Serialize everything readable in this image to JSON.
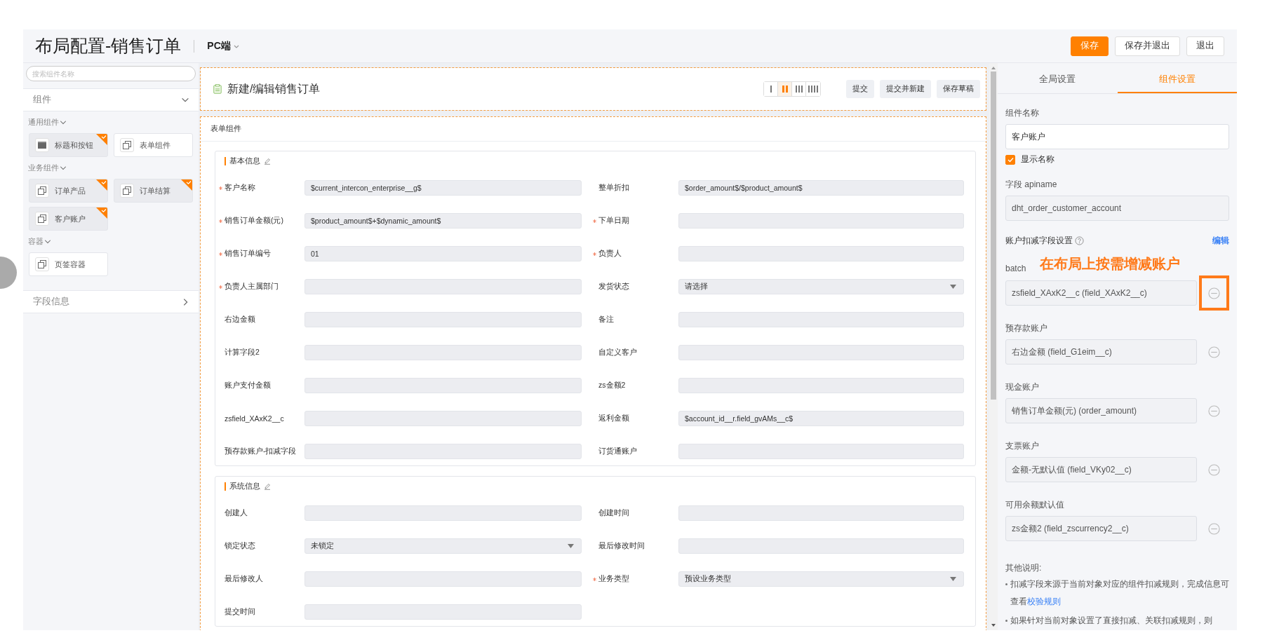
{
  "header": {
    "title": "布局配置-销售订单",
    "platform": "PC端",
    "buttons": [
      {
        "label": "保存",
        "primary": true
      },
      {
        "label": "保存并退出",
        "primary": false
      },
      {
        "label": "退出",
        "primary": false
      }
    ]
  },
  "left_panel": {
    "search": {
      "placeholder": "搜索组件名称"
    },
    "sections": [
      {
        "title": "组件",
        "expanded": true,
        "groups": [
          {
            "title": "通用组件",
            "expanded": true,
            "items": [
              {
                "label": "标题和按钮",
                "kind": "block",
                "added": true
              },
              {
                "label": "表单组件",
                "kind": "frame",
                "added": false
              }
            ]
          },
          {
            "title": "业务组件",
            "expanded": true,
            "items": [
              {
                "label": "订单产品",
                "kind": "frame",
                "added": true
              },
              {
                "label": "订单结算",
                "kind": "frame",
                "added": true
              },
              {
                "label": "客户账户",
                "kind": "frame",
                "added": true
              }
            ]
          },
          {
            "title": "容器",
            "expanded": true,
            "items": [
              {
                "label": "页签容器",
                "kind": "frame",
                "added": false
              }
            ]
          }
        ]
      },
      {
        "title": "字段信息",
        "expanded": false
      }
    ]
  },
  "canvas": {
    "title": "新建/编辑销售订单",
    "layout_options": [
      {
        "selected": false
      },
      {
        "selected": true
      },
      {
        "selected": false
      },
      {
        "selected": false
      }
    ],
    "buttons": [
      "提交",
      "提交并新建",
      "保存草稿"
    ],
    "form": {
      "title": "表单组件",
      "sections": [
        {
          "title": "基本信息",
          "fields": [
            {
              "label": "客户名称",
              "required": true,
              "kind": "text",
              "value": "$current_intercon_enterprise__g$"
            },
            {
              "label": "整单折扣",
              "required": false,
              "kind": "text",
              "value": "$order_amount$/$product_amount$"
            },
            {
              "label": "销售订单金额(元)",
              "required": true,
              "kind": "text",
              "value": "$product_amount$+$dynamic_amount$"
            },
            {
              "label": "下单日期",
              "required": true,
              "kind": "text"
            },
            {
              "label": "销售订单编号",
              "required": true,
              "kind": "text",
              "value": "01"
            },
            {
              "label": "负责人",
              "required": true,
              "kind": "text"
            },
            {
              "label": "负责人主属部门",
              "required": true,
              "kind": "text"
            },
            {
              "label": "发货状态",
              "required": false,
              "kind": "select",
              "value": "请选择"
            },
            {
              "label": "右边金额",
              "required": false,
              "kind": "text"
            },
            {
              "label": "备注",
              "required": false,
              "kind": "text"
            },
            {
              "label": "计算字段2",
              "required": false,
              "kind": "text"
            },
            {
              "label": "自定义客户",
              "required": false,
              "kind": "text"
            },
            {
              "label": "账户支付金额",
              "required": false,
              "kind": "text"
            },
            {
              "label": "zs金额2",
              "required": false,
              "kind": "text"
            },
            {
              "label": "zsfield_XAxK2__c",
              "required": false,
              "kind": "text"
            },
            {
              "label": "返利金额",
              "required": false,
              "kind": "text",
              "value": "$account_id__r.field_gvAMs__c$"
            },
            {
              "label": "预存款账户-扣减字段",
              "required": false,
              "kind": "text"
            },
            {
              "label": "订货通账户",
              "required": false,
              "kind": "text"
            }
          ]
        },
        {
          "title": "系统信息",
          "fields": [
            {
              "label": "创建人",
              "required": false,
              "kind": "text"
            },
            {
              "label": "创建时间",
              "required": false,
              "kind": "text"
            },
            {
              "label": "锁定状态",
              "required": false,
              "kind": "select",
              "value": "未锁定"
            },
            {
              "label": "最后修改时间",
              "required": false,
              "kind": "text"
            },
            {
              "label": "最后修改人",
              "required": false,
              "kind": "text"
            },
            {
              "label": "业务类型",
              "required": true,
              "kind": "select",
              "value": "预设业务类型"
            },
            {
              "label": "提交时间",
              "required": false,
              "kind": "text"
            }
          ]
        }
      ]
    }
  },
  "right_panel": {
    "tabs": [
      {
        "label": "全局设置",
        "selected": false
      },
      {
        "label": "组件设置",
        "selected": true
      }
    ],
    "component_name": {
      "label": "组件名称",
      "value": "客户账户"
    },
    "show_name": {
      "label": "显示名称",
      "checked": true
    },
    "apiname": {
      "label": "字段 apiname",
      "value": "dht_order_customer_account"
    },
    "deduction": {
      "title": "账户扣减字段设置",
      "edit_link": "编辑",
      "annotation": "在布局上按需增减账户",
      "accounts": [
        {
          "name": "batch",
          "value": "zsfield_XAxK2__c (field_XAxK2__c)",
          "highlighted": true
        },
        {
          "name": "预存款账户",
          "value": "右边金额 (field_G1eim__c)",
          "highlighted": false
        },
        {
          "name": "现金账户",
          "value": "销售订单金额(元) (order_amount)",
          "highlighted": false
        },
        {
          "name": "支票账户",
          "value": "金额-无默认值 (field_VKy02__c)",
          "highlighted": false
        },
        {
          "name": "可用余额默认值",
          "value": "zs金额2 (field_zscurrency2__c)",
          "highlighted": false
        }
      ]
    },
    "notes": {
      "title": "其他说明:",
      "items": [
        {
          "text": "扣减字段来源于当前对象对应的组件扣减规则，完成信息可查看",
          "link": "校验规则"
        },
        {
          "text": "如果针对当前对象设置了直接扣减、关联扣减规则，则"
        }
      ]
    }
  }
}
